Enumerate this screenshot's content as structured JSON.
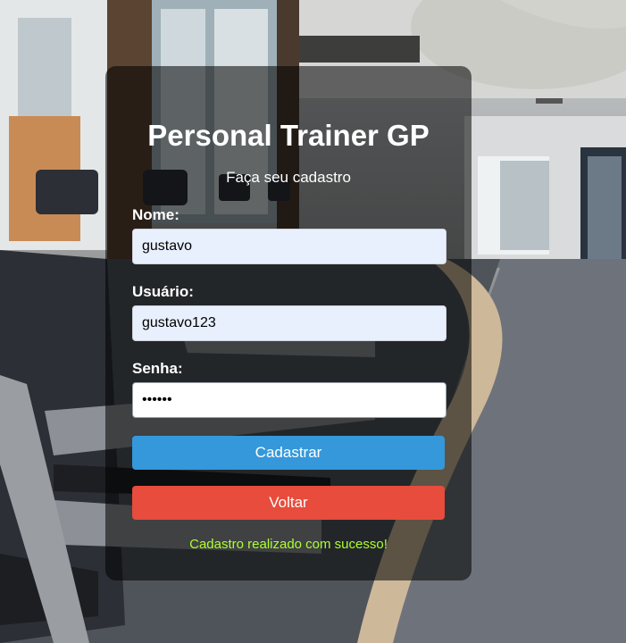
{
  "page": {
    "title": "Personal Trainer GP",
    "subtitle": "Faça seu cadastro"
  },
  "form": {
    "name_label": "Nome:",
    "name_value": "gustavo",
    "user_label": "Usuário:",
    "user_value": "gustavo123",
    "password_label": "Senha:",
    "password_value": "••••••",
    "submit_label": "Cadastrar",
    "back_label": "Voltar"
  },
  "status": {
    "message": "Cadastro realizado com sucesso!",
    "message_color": "#adff2f"
  },
  "colors": {
    "primary_button": "#3498db",
    "back_button": "#e74c3c",
    "card_background": "rgba(0,0,0,0.55)"
  },
  "background": {
    "icon": "gym-photo"
  }
}
